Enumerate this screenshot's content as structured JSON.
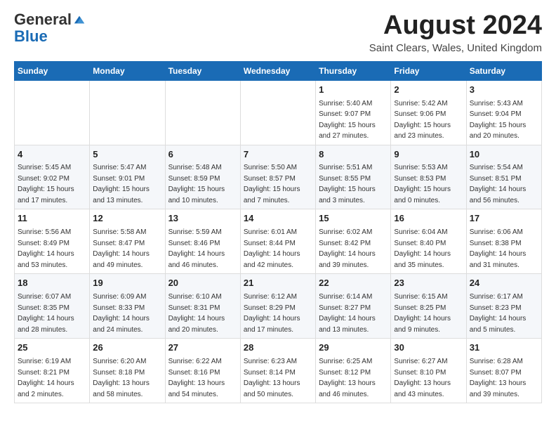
{
  "header": {
    "logo_general": "General",
    "logo_blue": "Blue",
    "month_title": "August 2024",
    "location": "Saint Clears, Wales, United Kingdom"
  },
  "days_of_week": [
    "Sunday",
    "Monday",
    "Tuesday",
    "Wednesday",
    "Thursday",
    "Friday",
    "Saturday"
  ],
  "weeks": [
    [
      {
        "day": "",
        "info": ""
      },
      {
        "day": "",
        "info": ""
      },
      {
        "day": "",
        "info": ""
      },
      {
        "day": "",
        "info": ""
      },
      {
        "day": "1",
        "info": "Sunrise: 5:40 AM\nSunset: 9:07 PM\nDaylight: 15 hours\nand 27 minutes."
      },
      {
        "day": "2",
        "info": "Sunrise: 5:42 AM\nSunset: 9:06 PM\nDaylight: 15 hours\nand 23 minutes."
      },
      {
        "day": "3",
        "info": "Sunrise: 5:43 AM\nSunset: 9:04 PM\nDaylight: 15 hours\nand 20 minutes."
      }
    ],
    [
      {
        "day": "4",
        "info": "Sunrise: 5:45 AM\nSunset: 9:02 PM\nDaylight: 15 hours\nand 17 minutes."
      },
      {
        "day": "5",
        "info": "Sunrise: 5:47 AM\nSunset: 9:01 PM\nDaylight: 15 hours\nand 13 minutes."
      },
      {
        "day": "6",
        "info": "Sunrise: 5:48 AM\nSunset: 8:59 PM\nDaylight: 15 hours\nand 10 minutes."
      },
      {
        "day": "7",
        "info": "Sunrise: 5:50 AM\nSunset: 8:57 PM\nDaylight: 15 hours\nand 7 minutes."
      },
      {
        "day": "8",
        "info": "Sunrise: 5:51 AM\nSunset: 8:55 PM\nDaylight: 15 hours\nand 3 minutes."
      },
      {
        "day": "9",
        "info": "Sunrise: 5:53 AM\nSunset: 8:53 PM\nDaylight: 15 hours\nand 0 minutes."
      },
      {
        "day": "10",
        "info": "Sunrise: 5:54 AM\nSunset: 8:51 PM\nDaylight: 14 hours\nand 56 minutes."
      }
    ],
    [
      {
        "day": "11",
        "info": "Sunrise: 5:56 AM\nSunset: 8:49 PM\nDaylight: 14 hours\nand 53 minutes."
      },
      {
        "day": "12",
        "info": "Sunrise: 5:58 AM\nSunset: 8:47 PM\nDaylight: 14 hours\nand 49 minutes."
      },
      {
        "day": "13",
        "info": "Sunrise: 5:59 AM\nSunset: 8:46 PM\nDaylight: 14 hours\nand 46 minutes."
      },
      {
        "day": "14",
        "info": "Sunrise: 6:01 AM\nSunset: 8:44 PM\nDaylight: 14 hours\nand 42 minutes."
      },
      {
        "day": "15",
        "info": "Sunrise: 6:02 AM\nSunset: 8:42 PM\nDaylight: 14 hours\nand 39 minutes."
      },
      {
        "day": "16",
        "info": "Sunrise: 6:04 AM\nSunset: 8:40 PM\nDaylight: 14 hours\nand 35 minutes."
      },
      {
        "day": "17",
        "info": "Sunrise: 6:06 AM\nSunset: 8:38 PM\nDaylight: 14 hours\nand 31 minutes."
      }
    ],
    [
      {
        "day": "18",
        "info": "Sunrise: 6:07 AM\nSunset: 8:35 PM\nDaylight: 14 hours\nand 28 minutes."
      },
      {
        "day": "19",
        "info": "Sunrise: 6:09 AM\nSunset: 8:33 PM\nDaylight: 14 hours\nand 24 minutes."
      },
      {
        "day": "20",
        "info": "Sunrise: 6:10 AM\nSunset: 8:31 PM\nDaylight: 14 hours\nand 20 minutes."
      },
      {
        "day": "21",
        "info": "Sunrise: 6:12 AM\nSunset: 8:29 PM\nDaylight: 14 hours\nand 17 minutes."
      },
      {
        "day": "22",
        "info": "Sunrise: 6:14 AM\nSunset: 8:27 PM\nDaylight: 14 hours\nand 13 minutes."
      },
      {
        "day": "23",
        "info": "Sunrise: 6:15 AM\nSunset: 8:25 PM\nDaylight: 14 hours\nand 9 minutes."
      },
      {
        "day": "24",
        "info": "Sunrise: 6:17 AM\nSunset: 8:23 PM\nDaylight: 14 hours\nand 5 minutes."
      }
    ],
    [
      {
        "day": "25",
        "info": "Sunrise: 6:19 AM\nSunset: 8:21 PM\nDaylight: 14 hours\nand 2 minutes."
      },
      {
        "day": "26",
        "info": "Sunrise: 6:20 AM\nSunset: 8:18 PM\nDaylight: 13 hours\nand 58 minutes."
      },
      {
        "day": "27",
        "info": "Sunrise: 6:22 AM\nSunset: 8:16 PM\nDaylight: 13 hours\nand 54 minutes."
      },
      {
        "day": "28",
        "info": "Sunrise: 6:23 AM\nSunset: 8:14 PM\nDaylight: 13 hours\nand 50 minutes."
      },
      {
        "day": "29",
        "info": "Sunrise: 6:25 AM\nSunset: 8:12 PM\nDaylight: 13 hours\nand 46 minutes."
      },
      {
        "day": "30",
        "info": "Sunrise: 6:27 AM\nSunset: 8:10 PM\nDaylight: 13 hours\nand 43 minutes."
      },
      {
        "day": "31",
        "info": "Sunrise: 6:28 AM\nSunset: 8:07 PM\nDaylight: 13 hours\nand 39 minutes."
      }
    ]
  ]
}
